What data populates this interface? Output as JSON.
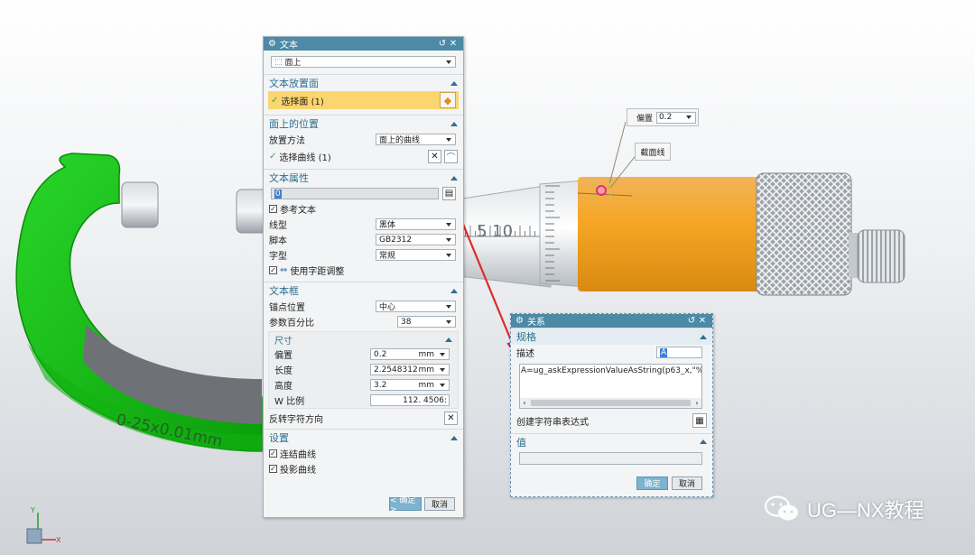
{
  "main_dialog": {
    "title": "文本",
    "type_value": "面上",
    "placement_face": {
      "header": "文本放置面",
      "select_label": "选择面 (1)"
    },
    "position": {
      "header": "面上的位置",
      "method_label": "放置方法",
      "method_value": "面上的曲线",
      "select_curve_label": "选择曲线 (1)"
    },
    "text_props": {
      "header": "文本属性",
      "text_value": "0",
      "reference_text_label": "参考文本",
      "font_label": "线型",
      "font_value": "黑体",
      "script_label": "脚本",
      "script_value": "GB2312",
      "style_label": "字型",
      "style_value": "常规",
      "kerning_label": "使用字距调整"
    },
    "text_box": {
      "header": "文本框",
      "anchor_label": "锚点位置",
      "anchor_value": "中心",
      "param_pct_label": "参数百分比",
      "param_pct_value": "38",
      "dims": {
        "header": "尺寸",
        "offset_label": "偏置",
        "offset_value": "0.2",
        "offset_unit": "mm",
        "length_label": "长度",
        "length_value": "2.25483127",
        "length_unit": "mm",
        "height_label": "高度",
        "height_value": "3.2",
        "height_unit": "mm",
        "wscale_label": "W 比例",
        "wscale_value": "112. 4506:"
      },
      "reverse_label": "反转字符方向"
    },
    "settings": {
      "header": "设置",
      "connect_label": "连结曲线",
      "project_label": "投影曲线"
    },
    "ok_label": "< 确定 >",
    "cancel_label": "取消"
  },
  "relation_dialog": {
    "title": "关系",
    "spec_header": "规格",
    "desc_label": "描述",
    "desc_value": "A",
    "expression": "A=ug_askExpressionValueAsString(p63_x,\"%.0f\"",
    "create_label": "创建字符串表达式",
    "value_header": "值",
    "value_text": "",
    "ok_label": "确定",
    "cancel_label": "取消"
  },
  "callouts": {
    "offset_label": "偏置",
    "offset_value": "0.2",
    "section_label": "截面线"
  },
  "model": {
    "frame_text": "0-25x0.01mm",
    "scale_text": "5 10",
    "accent_color": "#f6a623",
    "frame_color": "#16c416"
  },
  "watermark": {
    "text": "UG—NX教程"
  },
  "axis": {
    "x": "X",
    "y": "Y"
  }
}
